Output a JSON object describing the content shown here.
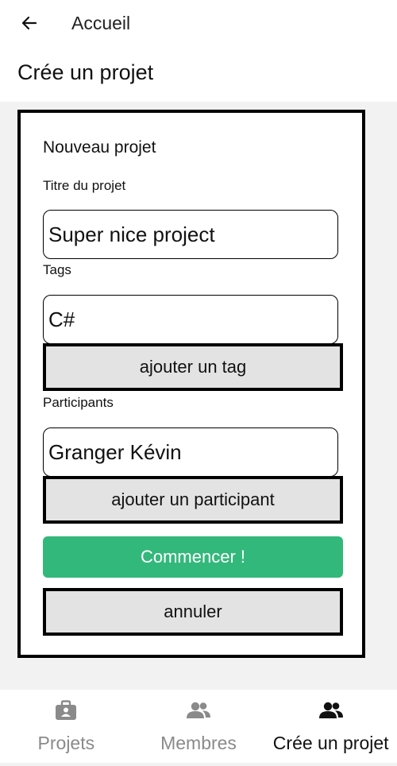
{
  "header": {
    "back_icon": "arrow-left-icon",
    "title": "Accueil"
  },
  "page": {
    "title": "Crée un projet"
  },
  "form": {
    "heading": "Nouveau projet",
    "project_title": {
      "label": "Titre du projet",
      "value": "Super nice project"
    },
    "tags": {
      "label": "Tags",
      "value": "C#",
      "add_button": "ajouter un tag"
    },
    "participants": {
      "label": "Participants",
      "value": "Granger Kévin",
      "add_button": "ajouter un participant"
    },
    "start_button": "Commencer !",
    "cancel_button": "annuler"
  },
  "tabbar": {
    "tabs": [
      {
        "label": "Projets",
        "icon": "briefcase-icon",
        "active": false
      },
      {
        "label": "Membres",
        "icon": "people-icon",
        "active": false
      },
      {
        "label": "Crée un projet",
        "icon": "people-icon",
        "active": true
      }
    ]
  },
  "colors": {
    "primary": "#33b87b",
    "tab_inactive": "#8a8a8a",
    "tab_active": "#111111",
    "button_fill": "#e3e3e3"
  }
}
